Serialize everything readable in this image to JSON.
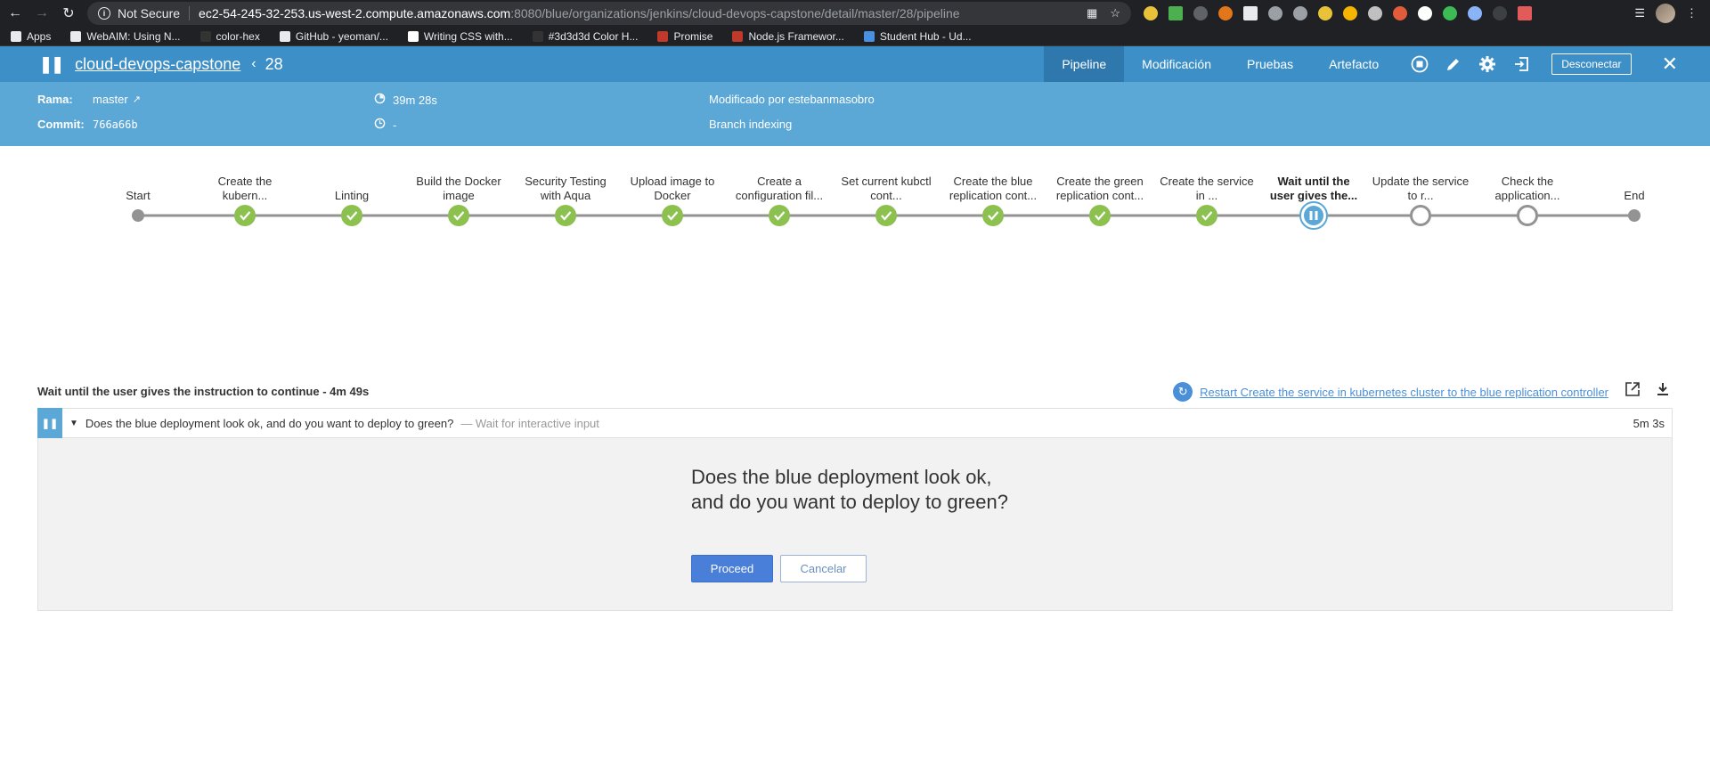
{
  "browser": {
    "not_secure_label": "Not Secure",
    "url_host": "ec2-54-245-32-253.us-west-2.compute.amazonaws.com",
    "url_path": ":8080/blue/organizations/jenkins/cloud-devops-capstone/detail/master/28/pipeline"
  },
  "bookmarks": [
    {
      "label": "Apps",
      "icon": "apps-grid-icon",
      "color": "#e8eaed"
    },
    {
      "label": "WebAIM: Using N...",
      "icon": "webaim-icon",
      "color": "#e8eaed"
    },
    {
      "label": "color-hex",
      "icon": "color-hex-icon",
      "color": "#333333"
    },
    {
      "label": "GitHub - yeoman/...",
      "icon": "github-icon",
      "color": "#e8eaed"
    },
    {
      "label": "Writing CSS with...",
      "icon": "medium-icon",
      "color": "#ffffff"
    },
    {
      "label": "#3d3d3d Color H...",
      "icon": "color-hex-icon",
      "color": "#333333"
    },
    {
      "label": "Promise",
      "icon": "promise-icon",
      "color": "#c0392b"
    },
    {
      "label": "Node.js Framewor...",
      "icon": "framework-icon",
      "color": "#c0392b"
    },
    {
      "label": "Student Hub - Ud...",
      "icon": "udacity-icon",
      "color": "#4a90e2"
    }
  ],
  "header": {
    "pipeline_name": "cloud-devops-capstone",
    "run_number": "28",
    "tabs": [
      "Pipeline",
      "Modificación",
      "Pruebas",
      "Artefacto"
    ],
    "logout_label": "Desconectar"
  },
  "info": {
    "branch_label": "Rama:",
    "branch_value": "master",
    "commit_label": "Commit:",
    "commit_value": "766a66b",
    "duration": "39m 28s",
    "time_ago": "-",
    "changes_by": "Modificado por estebanmasobro",
    "cause": "Branch indexing"
  },
  "stages": [
    {
      "label": "Start",
      "status": "start"
    },
    {
      "label": "Create the kubern...",
      "status": "success"
    },
    {
      "label": "Linting",
      "status": "success"
    },
    {
      "label": "Build the Docker image",
      "status": "success"
    },
    {
      "label": "Security Testing with Aqua",
      "status": "success"
    },
    {
      "label": "Upload image to Docker",
      "status": "success"
    },
    {
      "label": "Create a configuration fil...",
      "status": "success"
    },
    {
      "label": "Set current kubctl cont...",
      "status": "success"
    },
    {
      "label": "Create the blue replication cont...",
      "status": "success"
    },
    {
      "label": "Create the green replication cont...",
      "status": "success"
    },
    {
      "label": "Create the service in ...",
      "status": "success"
    },
    {
      "label": "Wait until the user gives the...",
      "status": "paused"
    },
    {
      "label": "Update the service to r...",
      "status": "not_built"
    },
    {
      "label": "Check the application...",
      "status": "not_built"
    },
    {
      "label": "End",
      "status": "end"
    }
  ],
  "colors": {
    "success": "#8cc04f",
    "paused": "#5ba7d6",
    "not_built": "#949393",
    "line": "#949393"
  },
  "step": {
    "title": "Wait until the user gives the instruction to continue - 4m 49s",
    "restart_label": "Restart Create the service in kubernetes cluster to the blue replication controller",
    "row_description": "Does the blue deployment look ok, and do you want to deploy to green?",
    "row_subtitle": "— Wait for interactive input",
    "row_duration": "5m 3s",
    "question_line1": "Does the blue deployment look ok,",
    "question_line2": "and do you want to deploy to green?",
    "proceed_label": "Proceed",
    "cancel_label": "Cancelar"
  }
}
